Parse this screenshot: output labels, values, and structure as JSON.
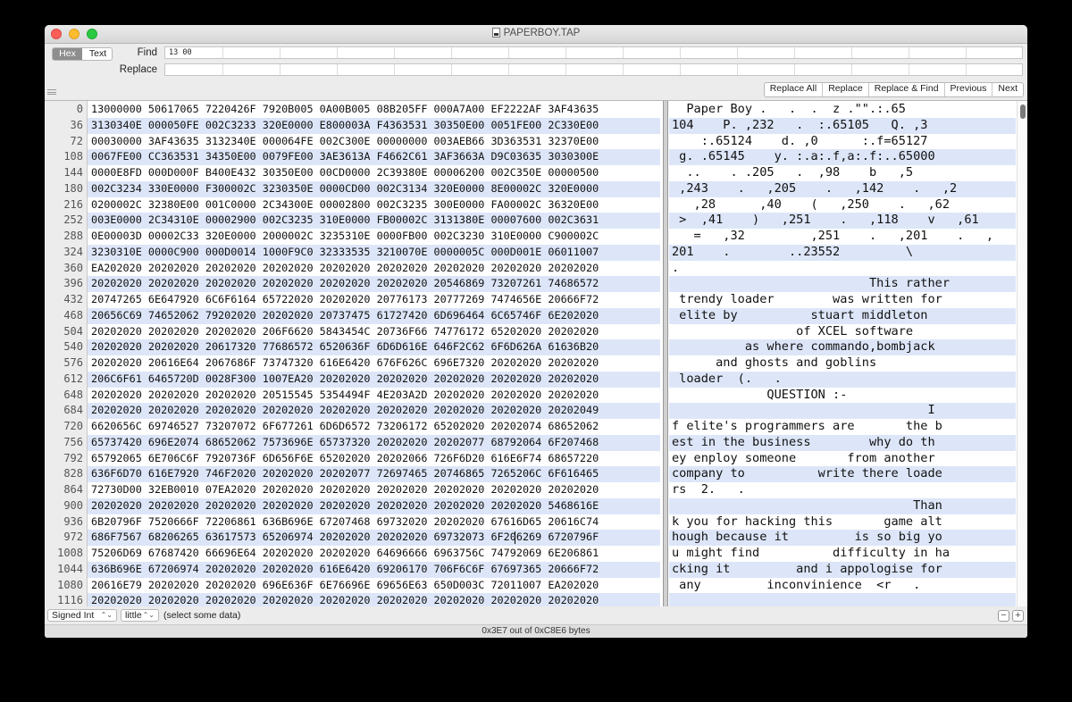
{
  "window": {
    "title": "PAPERBOY.TAP"
  },
  "toolbar": {
    "mode_options": [
      "Hex",
      "Text"
    ],
    "selected_mode": "Hex",
    "find_label": "Find",
    "find_value": "13 00",
    "replace_label": "Replace",
    "replace_value": "",
    "buttons": [
      "Replace All",
      "Replace",
      "Replace & Find",
      "Previous",
      "Next"
    ]
  },
  "rows": [
    {
      "offset": "0",
      "hex": "13000000 50617065 7220426F 7920B005 0A00B005 08B205FF 000A7A00 EF2222AF 3AF43635",
      "ascii": "  Paper Boy .   .  .  z .\"\".:.65"
    },
    {
      "offset": "36",
      "hex": "3130340E 000050FE 002C3233 320E0000 E800003A F4363531 30350E00 0051FE00 2C330E00",
      "ascii": "104    P. ,232   .  :.65105   Q. ,3"
    },
    {
      "offset": "72",
      "hex": "00030000 3AF43635 3132340E 000064FE 002C300E 00000000 003AEB66 3D363531 32370E00",
      "ascii": "    :.65124    d. ,0      :.f=65127"
    },
    {
      "offset": "108",
      "hex": "0067FE00 CC363531 34350E00 0079FE00 3AE3613A F4662C61 3AF3663A D9C03635 3030300E",
      "ascii": " g. .65145    y. :.a:.f,a:.f:..65000"
    },
    {
      "offset": "144",
      "hex": "0000E8FD 000D000F B400E432 30350E00 00CD0000 2C39380E 00006200 002C350E 00000500",
      "ascii": "  ..    . .205   .  ,98    b   ,5"
    },
    {
      "offset": "180",
      "hex": "002C3234 330E0000 F300002C 3230350E 0000CD00 002C3134 320E0000 8E00002C 320E0000",
      "ascii": " ,243    .   ,205    .   ,142    .   ,2"
    },
    {
      "offset": "216",
      "hex": "0200002C 32380E00 001C0000 2C34300E 00002800 002C3235 300E0000 FA00002C 36320E00",
      "ascii": "   ,28      ,40    (   ,250    .   ,62"
    },
    {
      "offset": "252",
      "hex": "003E0000 2C34310E 00002900 002C3235 310E0000 FB00002C 3131380E 00007600 002C3631",
      "ascii": " >  ,41    )   ,251    .   ,118    v   ,61"
    },
    {
      "offset": "288",
      "hex": "0E00003D 00002C33 320E0000 2000002C 3235310E 0000FB00 002C3230 310E0000 C900002C",
      "ascii": "   =   ,32         ,251    .   ,201    .   ,"
    },
    {
      "offset": "324",
      "hex": "3230310E 0000C900 000D0014 1000F9C0 32333535 3210070E 0000005C 000D001E 06011007",
      "ascii": "201    .        ..23552         \\"
    },
    {
      "offset": "360",
      "hex": "EA202020 20202020 20202020 20202020 20202020 20202020 20202020 20202020 20202020",
      "ascii": "."
    },
    {
      "offset": "396",
      "hex": "20202020 20202020 20202020 20202020 20202020 20202020 20546869 73207261 74686572",
      "ascii": "                           This rather"
    },
    {
      "offset": "432",
      "hex": "20747265 6E647920 6C6F6164 65722020 20202020 20776173 20777269 7474656E 20666F72",
      "ascii": " trendy loader        was written for"
    },
    {
      "offset": "468",
      "hex": "20656C69 74652062 79202020 20202020 20737475 61727420 6D696464 6C65746F 6E202020",
      "ascii": " elite by          stuart middleton"
    },
    {
      "offset": "504",
      "hex": "20202020 20202020 20202020 206F6620 5843454C 20736F66 74776172 65202020 20202020",
      "ascii": "                 of XCEL software"
    },
    {
      "offset": "540",
      "hex": "20202020 20202020 20617320 77686572 6520636F 6D6D616E 646F2C62 6F6D626A 61636B20",
      "ascii": "          as where commando,bombjack"
    },
    {
      "offset": "576",
      "hex": "20202020 20616E64 2067686F 73747320 616E6420 676F626C 696E7320 20202020 20202020",
      "ascii": "      and ghosts and goblins"
    },
    {
      "offset": "612",
      "hex": "206C6F61 6465720D 0028F300 1007EA20 20202020 20202020 20202020 20202020 20202020",
      "ascii": " loader  (.   ."
    },
    {
      "offset": "648",
      "hex": "20202020 20202020 20202020 20515545 5354494F 4E203A2D 20202020 20202020 20202020",
      "ascii": "             QUESTION :-"
    },
    {
      "offset": "684",
      "hex": "20202020 20202020 20202020 20202020 20202020 20202020 20202020 20202020 20202049",
      "ascii": "                                   I"
    },
    {
      "offset": "720",
      "hex": "6620656C 69746527 73207072 6F677261 6D6D6572 73206172 65202020 20202074 68652062",
      "ascii": "f elite's programmers are       the b"
    },
    {
      "offset": "756",
      "hex": "65737420 696E2074 68652062 7573696E 65737320 20202020 20202077 68792064 6F207468",
      "ascii": "est in the business        why do th"
    },
    {
      "offset": "792",
      "hex": "65792065 6E706C6F 7920736F 6D656F6E 65202020 20202066 726F6D20 616E6F74 68657220",
      "ascii": "ey enploy someone       from another"
    },
    {
      "offset": "828",
      "hex": "636F6D70 616E7920 746F2020 20202020 20202077 72697465 20746865 7265206C 6F616465",
      "ascii": "company to          write there loade"
    },
    {
      "offset": "864",
      "hex": "72730D00 32EB0010 07EA2020 20202020 20202020 20202020 20202020 20202020 20202020",
      "ascii": "rs  2.   ."
    },
    {
      "offset": "900",
      "hex": "20202020 20202020 20202020 20202020 20202020 20202020 20202020 20202020 5468616E",
      "ascii": "                                 Than"
    },
    {
      "offset": "936",
      "hex": "6B20796F 7520666F 72206861 636B696E 67207468 69732020 20202020 67616D65 20616C74",
      "ascii": "k you for hacking this       game alt"
    },
    {
      "offset": "972",
      "hex": "686F7567 68206265 63617573 65206974 20202020 20202020 69732073 6F206269 6720796F",
      "ascii": "hough because it         is so big yo"
    },
    {
      "offset": "1008",
      "hex": "75206D69 67687420 66696E64 20202020 20202020 64696666 6963756C 74792069 6E206861",
      "ascii": "u might find          difficulty in ha"
    },
    {
      "offset": "1044",
      "hex": "636B696E 67206974 20202020 20202020 616E6420 69206170 706F6C6F 67697365 20666F72",
      "ascii": "cking it         and i appologise for"
    },
    {
      "offset": "1080",
      "hex": "20616E79 20202020 20202020 696E636F 6E76696E 69656E63 650D003C 72011007 EA202020",
      "ascii": " any         inconvinience  <r   ."
    },
    {
      "offset": "1116",
      "hex": "20202020 20202020 20202020 20202020 20202020 20202020 20202020 20202020 20202020",
      "ascii": ""
    }
  ],
  "status": {
    "type_popup": "Signed Int",
    "endian_popup": "little",
    "message": "(select some data)",
    "minus": "−",
    "plus": "+"
  },
  "footer": {
    "text": "0x3E7 out of 0xC8E6 bytes"
  }
}
